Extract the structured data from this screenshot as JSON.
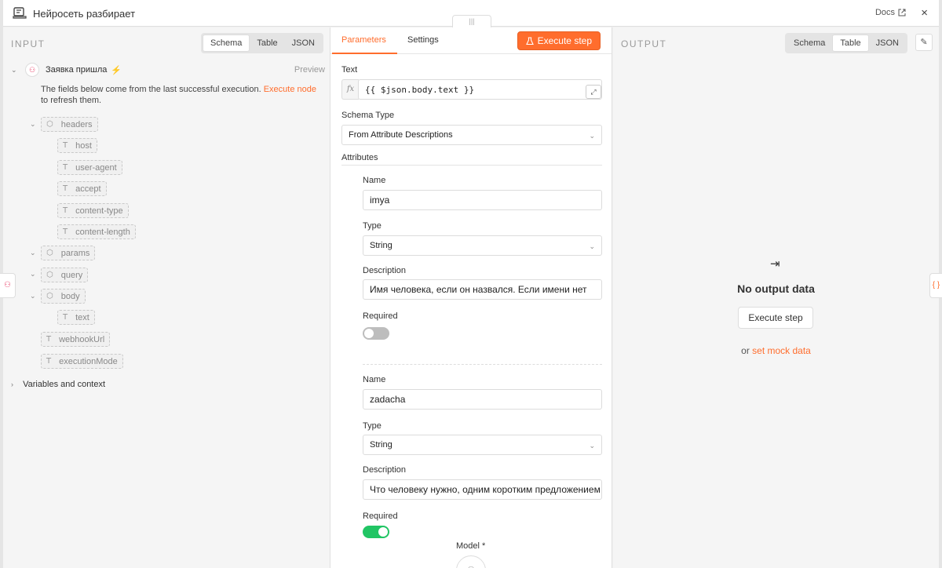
{
  "header": {
    "title": "Нейросеть разбирает",
    "docs_label": "Docs",
    "close_icon": "×",
    "drag_handle": "|||"
  },
  "input": {
    "label": "INPUT",
    "view_tabs": [
      "Schema",
      "Table",
      "JSON"
    ],
    "active_view": "Schema",
    "trigger_name": "Заявка пришла",
    "preview_label": "Preview",
    "info_text": "The fields below come from the last successful execution.",
    "info_link": "Execute node",
    "info_tail": "to refresh them.",
    "fields": {
      "headers": "headers",
      "host": "host",
      "user_agent": "user-agent",
      "accept": "accept",
      "content_type": "content-type",
      "content_length": "content-length",
      "params": "params",
      "query": "query",
      "body": "body",
      "text": "text",
      "webhook_url": "webhookUrl",
      "execution_mode": "executionMode"
    },
    "variables_label": "Variables and context"
  },
  "parameters": {
    "tabs": [
      "Parameters",
      "Settings"
    ],
    "active_tab": "Parameters",
    "execute_label": "Execute step",
    "text_label": "Text",
    "text_value": "{{ $json.body.text }}",
    "schema_type_label": "Schema Type",
    "schema_type_value": "From Attribute Descriptions",
    "attributes_label": "Attributes",
    "attributes": [
      {
        "name_label": "Name",
        "name": "imya",
        "type_label": "Type",
        "type": "String",
        "description_label": "Description",
        "description": "Имя человека, если он назвался. Если имени нет",
        "required_label": "Required",
        "required": false
      },
      {
        "name_label": "Name",
        "name": "zadacha",
        "type_label": "Type",
        "type": "String",
        "description_label": "Description",
        "description": "Что человеку нужно, одним коротким предложением",
        "required_label": "Required",
        "required": true
      }
    ],
    "model_label": "Model *"
  },
  "output": {
    "label": "OUTPUT",
    "view_tabs": [
      "Schema",
      "Table",
      "JSON"
    ],
    "active_view": "Table",
    "empty_title": "No output data",
    "execute_label": "Execute step",
    "mock_prefix": "or",
    "mock_link": "set mock data"
  },
  "colors": {
    "accent": "#ff6d2d",
    "toggle_on": "#21c564",
    "trigger": "#ea4b71"
  }
}
